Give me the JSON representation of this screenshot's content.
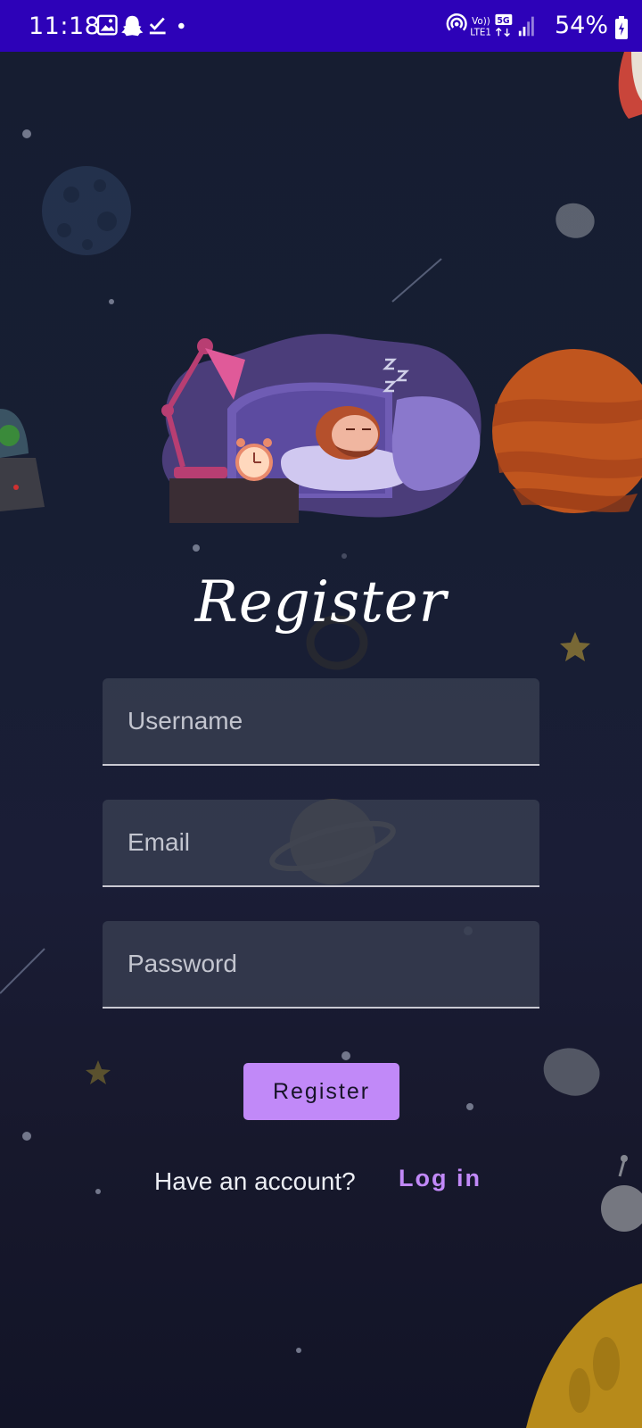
{
  "status_bar": {
    "time": "11:18",
    "battery": "54%",
    "network_label_top": "Vo))",
    "network_label_bottom": "LTE1",
    "network_5g": "5G",
    "icons": [
      "gallery-icon",
      "snapchat-icon",
      "download-done-icon",
      "dot-icon",
      "hotspot-icon",
      "signal-icon",
      "battery-icon"
    ]
  },
  "form": {
    "title": "Register",
    "username_placeholder": "Username",
    "email_placeholder": "Email",
    "password_placeholder": "Password",
    "register_button_label": "Register"
  },
  "footer": {
    "account_prompt": "Have an account?",
    "login_label": "Log in"
  },
  "colors": {
    "status_bar": "#2d02b8",
    "accent": "#c189f8",
    "background": "#161d31"
  }
}
